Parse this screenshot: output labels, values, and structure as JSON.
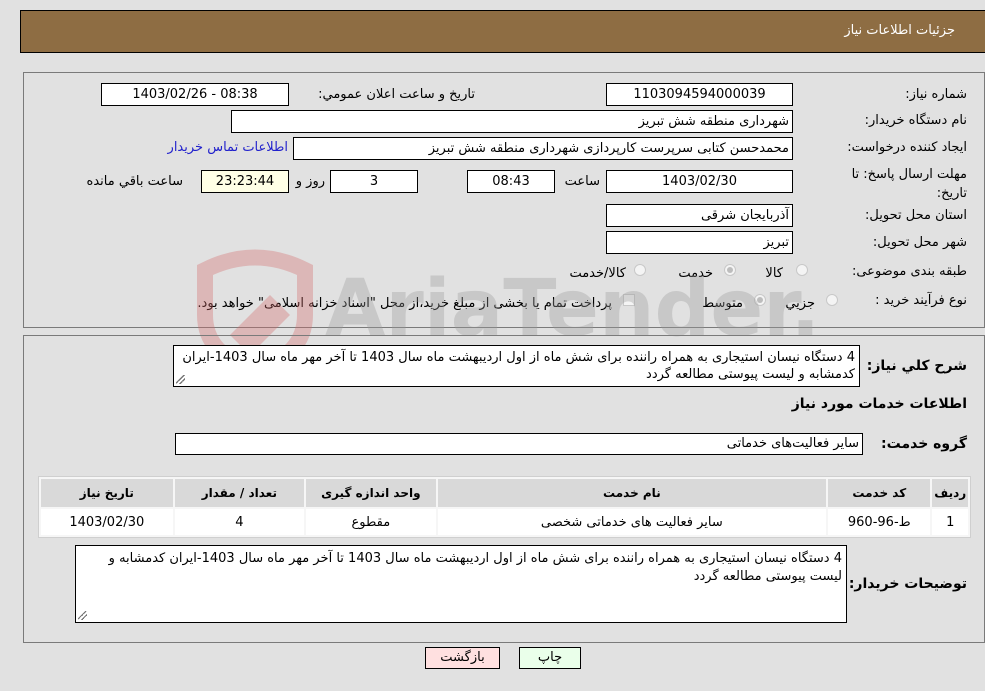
{
  "header": {
    "title": "جزئیات اطلاعات نیاز"
  },
  "form": {
    "need_number_label": "شماره نیاز:",
    "need_number": "1103094594000039",
    "announce_label": "تاریخ و ساعت اعلان عمومي:",
    "announce_value": "1403/02/26 - 08:38",
    "buyer_org_label": "نام دستگاه خریدار:",
    "buyer_org": "شهرداری منطقه شش تبریز",
    "creator_label": "ایجاد کننده درخواست:",
    "creator": "محمدحسن کتابی سرپرست کارپردازی شهرداری منطقه شش تبریز",
    "contact_link": "اطلاعات تماس خریدار",
    "deadline_label": "مهلت ارسال پاسخ: تا تاریخ:",
    "deadline_date": "1403/02/30",
    "time_label": "ساعت",
    "deadline_time": "08:43",
    "days": "3",
    "days_label": "روز و",
    "remaining": "23:23:44",
    "remaining_label": "ساعت باقي مانده",
    "province_label": "استان محل تحویل:",
    "province": "آذربایجان شرقی",
    "city_label": "شهر محل تحویل:",
    "city": "تبریز",
    "category_label": "طبقه بندی موضوعی:",
    "category_options": [
      {
        "label": "کالا",
        "checked": false
      },
      {
        "label": "خدمت",
        "checked": true
      },
      {
        "label": "کالا/خدمت",
        "checked": false
      }
    ],
    "process_label": "نوع فرآیند خرید :",
    "process_options": [
      {
        "label": "جزيي",
        "checked": false
      },
      {
        "label": "متوسط",
        "checked": true
      }
    ],
    "treasury_checkbox_label": "پرداخت تمام یا بخشی از مبلغ خرید،از محل \"اسناد خزانه اسلامی\" خواهد بود.",
    "treasury_checked": false
  },
  "details": {
    "summary_label": "شرح کلي نیاز:",
    "summary": "4 دستگاه نیسان استیجاری به همراه راننده برای شش ماه از اول اردیبهشت ماه سال 1403 تا آخر مهر ماه سال 1403-ایران کدمشابه و لیست پیوستی مطالعه گردد",
    "services_heading": "اطلاعات خدمات مورد نیاز",
    "service_group_label": "گروه خدمت:",
    "service_group": "سایر فعالیت‌های خدماتی",
    "table": {
      "columns": [
        "ردیف",
        "کد خدمت",
        "نام خدمت",
        "واحد اندازه گیری",
        "تعداد / مقدار",
        "تاریخ نیاز"
      ],
      "rows": [
        [
          "1",
          "ط-96-960",
          "سایر فعالیت های خدماتی شخصی",
          "مقطوع",
          "4",
          "1403/02/30"
        ]
      ]
    },
    "buyer_notes_label": "توضیحات خریدار:",
    "buyer_notes": "4 دستگاه نیسان استیجاری به همراه راننده برای شش ماه از اول اردیبهشت ماه سال 1403 تا آخر مهر ماه سال 1403-ایران کدمشابه و لیست پیوستی مطالعه گردد"
  },
  "buttons": {
    "print": "چاپ",
    "back": "بازگشت"
  },
  "watermark": {
    "text": "AriaTender.neT"
  },
  "colors": {
    "header": "#8e6d43",
    "print_bg": "#eaffea",
    "back_bg": "#ffe0e0",
    "link": "#2222cc"
  }
}
